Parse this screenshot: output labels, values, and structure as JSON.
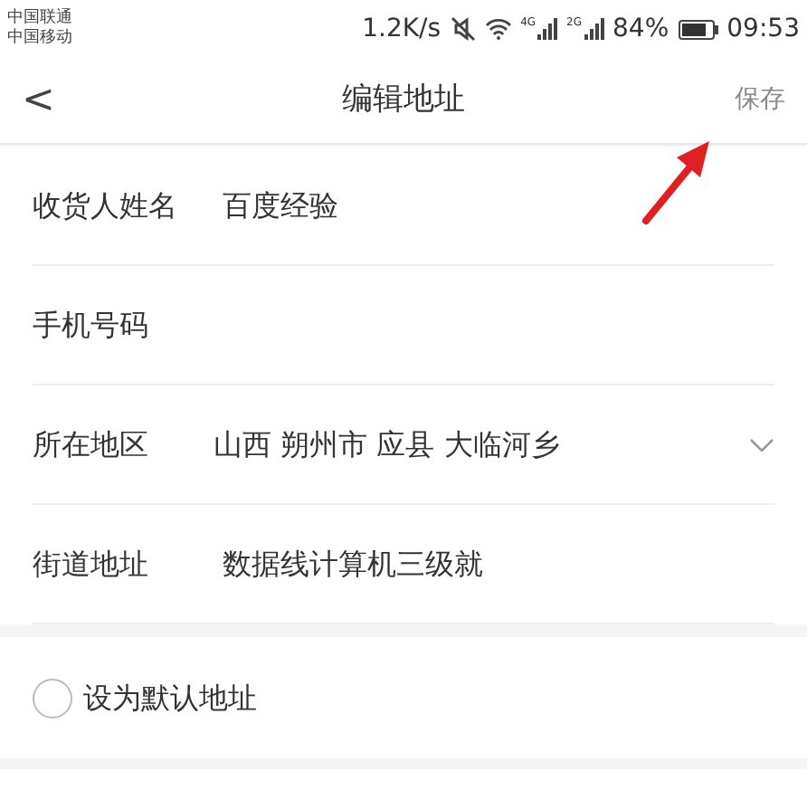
{
  "status_bar": {
    "carriers": [
      "中国联通",
      "中国移动"
    ],
    "speed": "1.2K/s",
    "signals": [
      "4G",
      "2G"
    ],
    "battery": "84%",
    "time": "09:53"
  },
  "header": {
    "back": "<",
    "title": "编辑地址",
    "action": "保存"
  },
  "rows": [
    {
      "kind": "field",
      "label": "收货人姓名",
      "value": "百度经验"
    },
    {
      "kind": "field",
      "label": "手机号码"
    },
    {
      "kind": "region",
      "label": "所在地区",
      "value": "山西 朔州市 应县 大临河乡"
    },
    {
      "kind": "field",
      "label": "街道地址",
      "value": "数据线计算机三级就"
    }
  ],
  "default_address": {
    "label": "设为默认地址",
    "checked": false
  }
}
